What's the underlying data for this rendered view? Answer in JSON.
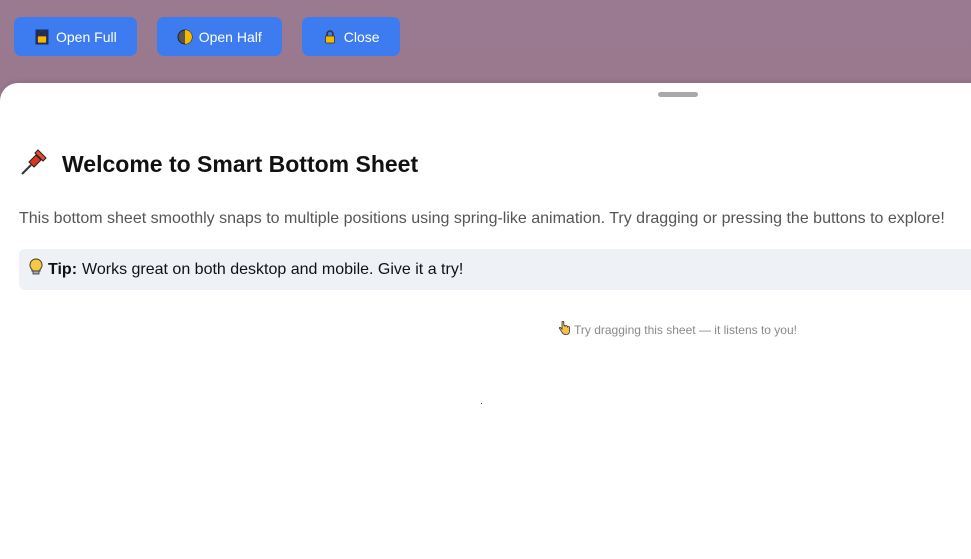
{
  "toolbar": {
    "buttons": [
      {
        "label": "Open Full",
        "icon": "lock-icon"
      },
      {
        "label": "Open Half",
        "icon": "half-moon-icon"
      },
      {
        "label": "Close",
        "icon": "lock-icon"
      }
    ]
  },
  "sheet": {
    "title": "Welcome to Smart Bottom Sheet",
    "title_icon": "pushpin-icon",
    "description": "This bottom sheet smoothly snaps to multiple positions using spring-like animation. Try dragging or pressing the buttons to explore!",
    "tip": {
      "icon": "lightbulb-icon",
      "label": "Tip:",
      "text": "Works great on both desktop and mobile. Give it a try!"
    },
    "hint": {
      "icon": "pointing-hand-icon",
      "text": "Try dragging this sheet — it listens to you!"
    }
  },
  "colors": {
    "backdrop": "#977389",
    "button": "#3d7cf0",
    "tip_background": "#eef2f7"
  }
}
